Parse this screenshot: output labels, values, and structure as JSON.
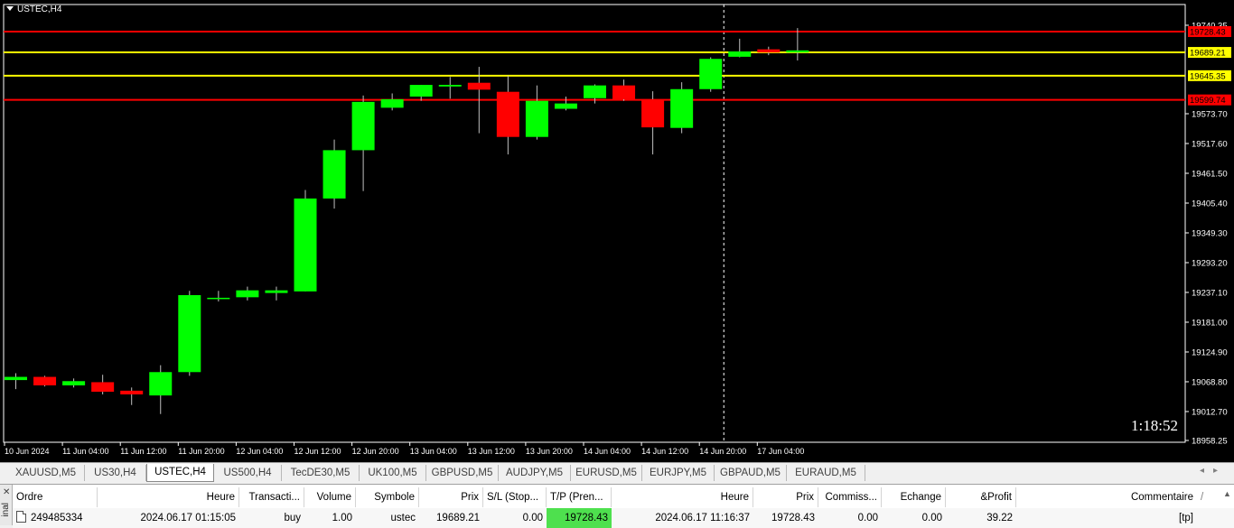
{
  "chart": {
    "symbol_label": "USTEC,H4",
    "countdown": "1:18:52",
    "colors": {
      "background": "#000000",
      "bull": "#00ff00",
      "bear": "#ff0000",
      "wick": "#c0c0c0",
      "axis_text": "#ffffff",
      "tp_line": "#ff0000",
      "entry_line": "#ffff00"
    },
    "y_ticks": [
      "19740.35",
      "19573.70",
      "19517.60",
      "19461.50",
      "19405.40",
      "19349.30",
      "19293.20",
      "19237.10",
      "19181.00",
      "19124.90",
      "19068.80",
      "19012.70",
      "18958.25"
    ],
    "y_tick_values": [
      19740.35,
      19573.7,
      19517.6,
      19461.5,
      19405.4,
      19349.3,
      19293.2,
      19237.1,
      19181.0,
      19124.9,
      19068.8,
      19012.7,
      18958.25
    ],
    "x_ticks": [
      "10 Jun 2024",
      "11 Jun 04:00",
      "11 Jun 12:00",
      "11 Jun 20:00",
      "12 Jun 04:00",
      "12 Jun 12:00",
      "12 Jun 20:00",
      "13 Jun 04:00",
      "13 Jun 12:00",
      "13 Jun 20:00",
      "14 Jun 04:00",
      "14 Jun 12:00",
      "14 Jun 20:00",
      "17 Jun 04:00"
    ],
    "price_lines": [
      {
        "label": "19728.43",
        "value": 19728.43,
        "kind": "tp"
      },
      {
        "label": "19689.21",
        "value": 19689.21,
        "kind": "entry"
      },
      {
        "label": "19645.35",
        "value": 19645.35,
        "kind": "entry"
      },
      {
        "label": "19599.74",
        "value": 19599.74,
        "kind": "tp"
      }
    ],
    "crosshair_bar_index": 25,
    "candles": [
      {
        "o": 19072,
        "h": 19085,
        "l": 19055,
        "c": 19078
      },
      {
        "o": 19078,
        "h": 19080,
        "l": 19060,
        "c": 19062
      },
      {
        "o": 19062,
        "h": 19075,
        "l": 19058,
        "c": 19070
      },
      {
        "o": 19068,
        "h": 19082,
        "l": 19045,
        "c": 19050
      },
      {
        "o": 19052,
        "h": 19058,
        "l": 19025,
        "c": 19045
      },
      {
        "o": 19043,
        "h": 19100,
        "l": 19008,
        "c": 19087
      },
      {
        "o": 19087,
        "h": 19240,
        "l": 19080,
        "c": 19232
      },
      {
        "o": 19225,
        "h": 19240,
        "l": 19220,
        "c": 19227
      },
      {
        "o": 19228,
        "h": 19248,
        "l": 19222,
        "c": 19241
      },
      {
        "o": 19236,
        "h": 19248,
        "l": 19222,
        "c": 19241
      },
      {
        "o": 19239,
        "h": 19430,
        "l": 19239,
        "c": 19414
      },
      {
        "o": 19414,
        "h": 19525,
        "l": 19395,
        "c": 19505
      },
      {
        "o": 19505,
        "h": 19608,
        "l": 19428,
        "c": 19596
      },
      {
        "o": 19585,
        "h": 19612,
        "l": 19580,
        "c": 19601
      },
      {
        "o": 19606,
        "h": 19628,
        "l": 19598,
        "c": 19628
      },
      {
        "o": 19625,
        "h": 19643,
        "l": 19602,
        "c": 19628
      },
      {
        "o": 19632,
        "h": 19662,
        "l": 19537,
        "c": 19619
      },
      {
        "o": 19615,
        "h": 19645,
        "l": 19497,
        "c": 19530
      },
      {
        "o": 19530,
        "h": 19627,
        "l": 19525,
        "c": 19598
      },
      {
        "o": 19583,
        "h": 19606,
        "l": 19580,
        "c": 19593
      },
      {
        "o": 19603,
        "h": 19629,
        "l": 19593,
        "c": 19627
      },
      {
        "o": 19627,
        "h": 19638,
        "l": 19598,
        "c": 19601
      },
      {
        "o": 19601,
        "h": 19616,
        "l": 19497,
        "c": 19548
      },
      {
        "o": 19547,
        "h": 19633,
        "l": 19537,
        "c": 19620
      },
      {
        "o": 19620,
        "h": 19680,
        "l": 19615,
        "c": 19677
      },
      {
        "o": 19681,
        "h": 19715,
        "l": 19680,
        "c": 19691
      },
      {
        "o": 19695,
        "h": 19700,
        "l": 19684,
        "c": 19689
      },
      {
        "o": 19689,
        "h": 19735,
        "l": 19674,
        "c": 19693
      }
    ]
  },
  "tabs": {
    "items": [
      "XAUUSD,M5",
      "US30,H4",
      "USTEC,H4",
      "US500,H4",
      "TecDE30,M5",
      "UK100,M5",
      "GBPUSD,M5",
      "AUDJPY,M5",
      "EURUSD,M5",
      "EURJPY,M5",
      "GBPAUD,M5",
      "EURAUD,M5"
    ],
    "active_index": 2
  },
  "terminal": {
    "side_label": "inal",
    "headers": {
      "ordre": "Ordre",
      "heure_open": "Heure",
      "transaction": "Transacti...",
      "volume": "Volume",
      "symbole": "Symbole",
      "prix_open": "Prix",
      "sl": "S/L (Stop...",
      "tp": "T/P (Pren...",
      "heure_close": "Heure",
      "prix_close": "Prix",
      "commission": "Commiss...",
      "echange": "Echange",
      "profit": "&Profit",
      "commentaire": "Commentaire"
    },
    "row": {
      "ordre": "249485334",
      "heure_open": "2024.06.17 01:15:05",
      "transaction": "buy",
      "volume": "1.00",
      "symbole": "ustec",
      "prix_open": "19689.21",
      "sl": "0.00",
      "tp": "19728.43",
      "heure_close": "2024.06.17 11:16:37",
      "prix_close": "19728.43",
      "commission": "0.00",
      "echange": "0.00",
      "profit": "39.22",
      "commentaire": "[tp]"
    }
  }
}
